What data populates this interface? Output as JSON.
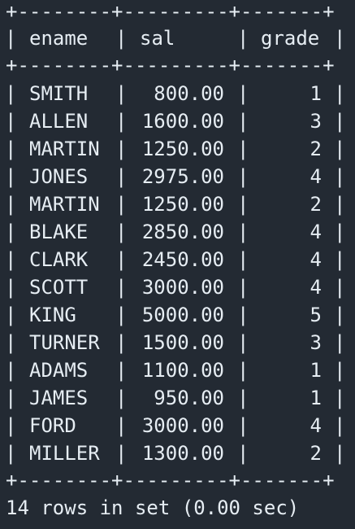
{
  "table": {
    "border": "+--------+---------+-------+",
    "headers": {
      "ename": "ename",
      "sal": "sal",
      "grade": "grade"
    },
    "rows": [
      {
        "ename": "SMITH",
        "sal": "800.00",
        "grade": "1"
      },
      {
        "ename": "ALLEN",
        "sal": "1600.00",
        "grade": "3"
      },
      {
        "ename": "MARTIN",
        "sal": "1250.00",
        "grade": "2"
      },
      {
        "ename": "JONES",
        "sal": "2975.00",
        "grade": "4"
      },
      {
        "ename": "MARTIN",
        "sal": "1250.00",
        "grade": "2"
      },
      {
        "ename": "BLAKE",
        "sal": "2850.00",
        "grade": "4"
      },
      {
        "ename": "CLARK",
        "sal": "2450.00",
        "grade": "4"
      },
      {
        "ename": "SCOTT",
        "sal": "3000.00",
        "grade": "4"
      },
      {
        "ename": "KING",
        "sal": "5000.00",
        "grade": "5"
      },
      {
        "ename": "TURNER",
        "sal": "1500.00",
        "grade": "3"
      },
      {
        "ename": "ADAMS",
        "sal": "1100.00",
        "grade": "1"
      },
      {
        "ename": "JAMES",
        "sal": "950.00",
        "grade": "1"
      },
      {
        "ename": "FORD",
        "sal": "3000.00",
        "grade": "4"
      },
      {
        "ename": "MILLER",
        "sal": "1300.00",
        "grade": "2"
      }
    ]
  },
  "status": "14 rows in set (0.00 sec)",
  "colors": {
    "background": "#232a33",
    "text": "#e6edf3"
  }
}
